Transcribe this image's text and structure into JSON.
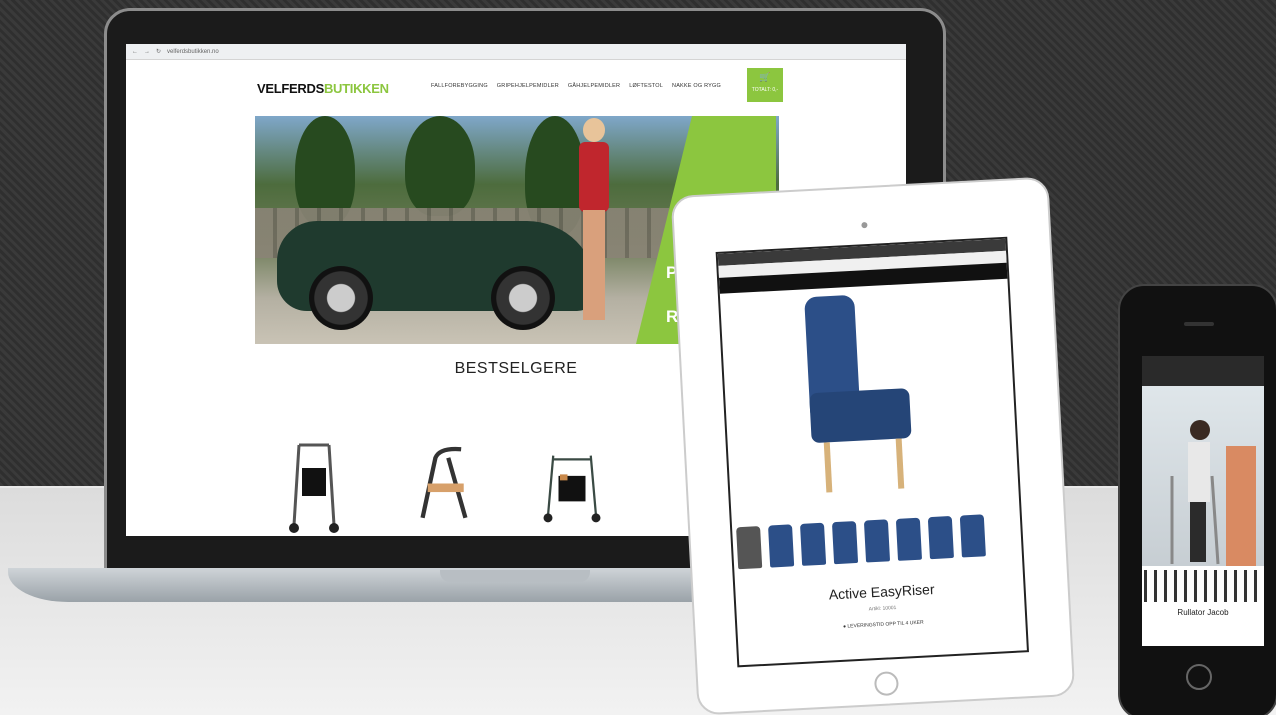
{
  "laptop": {
    "browser": {
      "nav_icons": [
        "back-icon",
        "forward-icon",
        "reload-icon"
      ],
      "url": "velferdsbutikken.no"
    },
    "site": {
      "logo_part1": "VELFERDS",
      "logo_part2": "BUTIKKEN",
      "nav": [
        "FALLFOREBYGGING",
        "GRIPEHJELPEMIDLER",
        "GÅHJELPEMIDLER",
        "LØFTESTOL",
        "NAKKE OG RYGG"
      ],
      "cart_label": "TOTALT: 0,-",
      "hero_text": [
        "PREI",
        "KA",
        "RULL"
      ],
      "section_title": "BESTSELGERE"
    }
  },
  "tablet": {
    "product_title": "Active EasyRiser",
    "product_sub": "Artikl: 10001",
    "product_sub2": "● LEVERINGSTID OPP TIL 4 UKER"
  },
  "phone": {
    "caption": "Rullator Jacob"
  },
  "colors": {
    "brand_green": "#8cc63f",
    "chair_blue": "#2c4f88"
  }
}
